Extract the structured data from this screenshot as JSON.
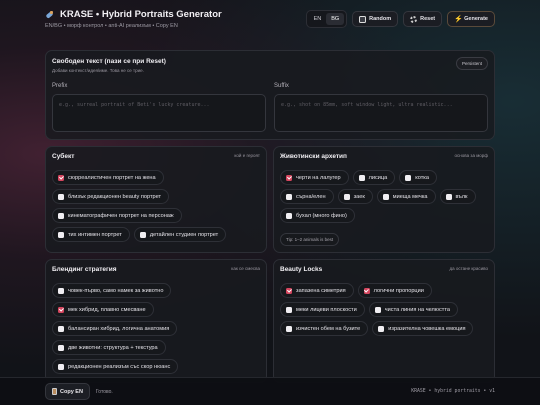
{
  "header": {
    "title": "KRASE • Hybrid Portraits Generator",
    "subtitle": "EN/BG • морф контрол • anti-AI реализъм • Copy EN",
    "lang": [
      "EN",
      "BG"
    ],
    "random_label": "Random",
    "reset_label": "Reset",
    "generate_label": "Generate"
  },
  "free_text": {
    "title": "Свободен текст (пази се при Reset)",
    "note": "Добави контекст/идея/име. Това не се трие.",
    "badge": "Persistent",
    "prefix_label": "Prefix",
    "prefix_placeholder": "e.g., surreal portrait of Beti's lucky creature...",
    "suffix_label": "Suffix",
    "suffix_placeholder": "e.g., shot on 85mm, soft window light, ultra realistic..."
  },
  "subject": {
    "title": "Субект",
    "note": "кой е героят",
    "options": [
      {
        "label": "сюрреалистичен портрет на жена",
        "checked": true
      },
      {
        "label": "близък редакционен beauty портрет",
        "checked": false
      },
      {
        "label": "кинематографичен портрет на персонаж",
        "checked": false
      },
      {
        "label": "тих интимен портрет",
        "checked": false
      },
      {
        "label": "детайлен студиен портрет",
        "checked": false
      }
    ]
  },
  "animal": {
    "title": "Животински архетип",
    "note": "основа за морф",
    "options": [
      {
        "label": "черти на лалугер",
        "checked": true
      },
      {
        "label": "лисица",
        "checked": false
      },
      {
        "label": "котка",
        "checked": false
      },
      {
        "label": "сърна/елен",
        "checked": false
      },
      {
        "label": "заек",
        "checked": false
      },
      {
        "label": "миеща мечка",
        "checked": false
      },
      {
        "label": "вълк",
        "checked": false
      },
      {
        "label": "бухал (много фино)",
        "checked": false
      }
    ],
    "tip": "Tip: 1–2 animals is best"
  },
  "blend": {
    "title": "Блендинг стратегия",
    "note": "как се смесва",
    "options": [
      {
        "label": "човек-първо, само намек за животно",
        "checked": false
      },
      {
        "label": "мек хибрид, плавно смесване",
        "checked": true
      },
      {
        "label": "балансиран хибрид, логична анатомия",
        "checked": false
      },
      {
        "label": "две животни: структура + текстура",
        "checked": false
      },
      {
        "label": "редакционен реализъм със скор нюанс",
        "checked": false
      }
    ]
  },
  "beauty": {
    "title": "Beauty Locks",
    "note": "да остане красиво",
    "options": [
      {
        "label": "запазена симетрия",
        "checked": true
      },
      {
        "label": "логични пропорции",
        "checked": true
      },
      {
        "label": "меки лицеви плоскости",
        "checked": false
      },
      {
        "label": "чиста линия на челюстта",
        "checked": false
      },
      {
        "label": "изчистен обем на бузите",
        "checked": false
      },
      {
        "label": "изразителна човешка емоция",
        "checked": false
      }
    ]
  },
  "footer": {
    "copy_label": "Copy EN",
    "status": "Готово.",
    "credit": "KRASE • hybrid portraits • v1"
  },
  "colors": {
    "accent": "#d4455e",
    "background": "#111318",
    "card": "#181a1f"
  }
}
